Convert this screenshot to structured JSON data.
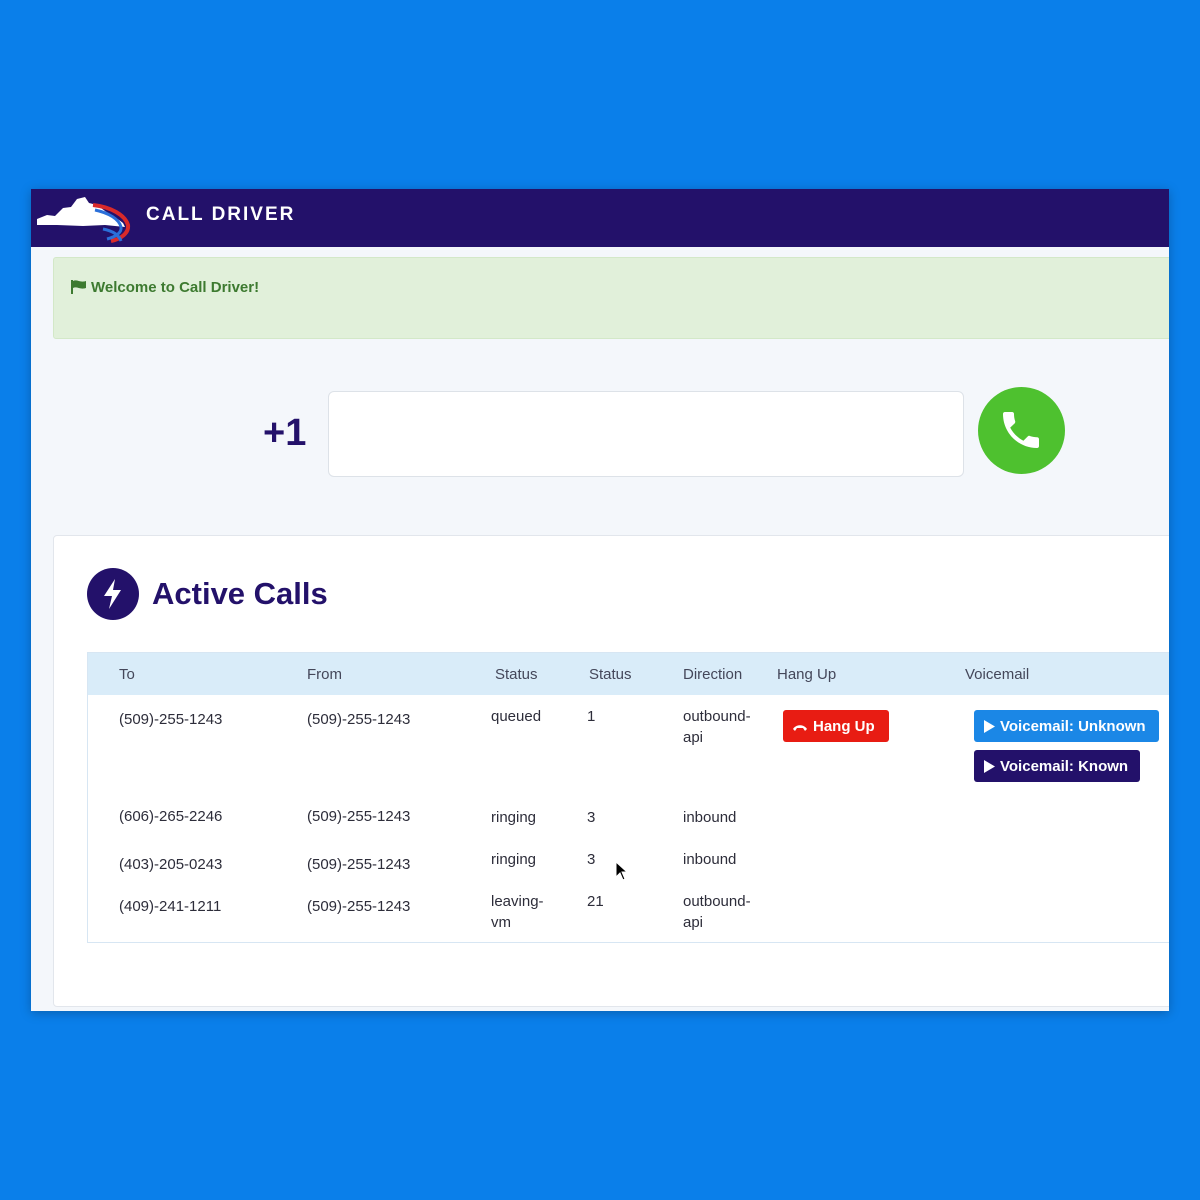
{
  "navbar": {
    "brand": "CALL DRIVER",
    "logo_icon": "virginia-map-logo"
  },
  "alert": {
    "icon": "flag-icon",
    "text": "Welcome to Call Driver!"
  },
  "dialer": {
    "prefix": "+1",
    "phone_value": "",
    "call_icon": "phone-icon"
  },
  "active_calls": {
    "icon": "bolt-icon",
    "title": "Active Calls",
    "columns": [
      "To",
      "From",
      "Status",
      "Status",
      "Direction",
      "Hang Up",
      "Voicemail"
    ],
    "rows": [
      {
        "to": "(509)-255-1243",
        "from": "(509)-255-1243",
        "status": "queued",
        "count": "1",
        "direction": "outbound-api",
        "hang_up_label": "Hang Up",
        "vm_unknown_label": "Voicemail: Unknown",
        "vm_known_label": "Voicemail: Known"
      },
      {
        "to": "(606)-265-2246",
        "from": "(509)-255-1243",
        "status": "ringing",
        "count": "3",
        "direction": "inbound"
      },
      {
        "to": "(403)-205-0243",
        "from": "(509)-255-1243",
        "status": "ringing",
        "count": "3",
        "direction": "inbound"
      },
      {
        "to": "(409)-241-1211",
        "from": "(509)-255-1243",
        "status": "leaving-vm",
        "count": "21",
        "direction": "outbound-api"
      }
    ]
  },
  "colors": {
    "background": "#0a7fea",
    "navbar": "#23116a",
    "call_button": "#4ec12f",
    "hang_up": "#e81c13",
    "voicemail_unknown": "#1b87e6",
    "voicemail_known": "#23116a",
    "alert_bg": "#e1f0da"
  }
}
